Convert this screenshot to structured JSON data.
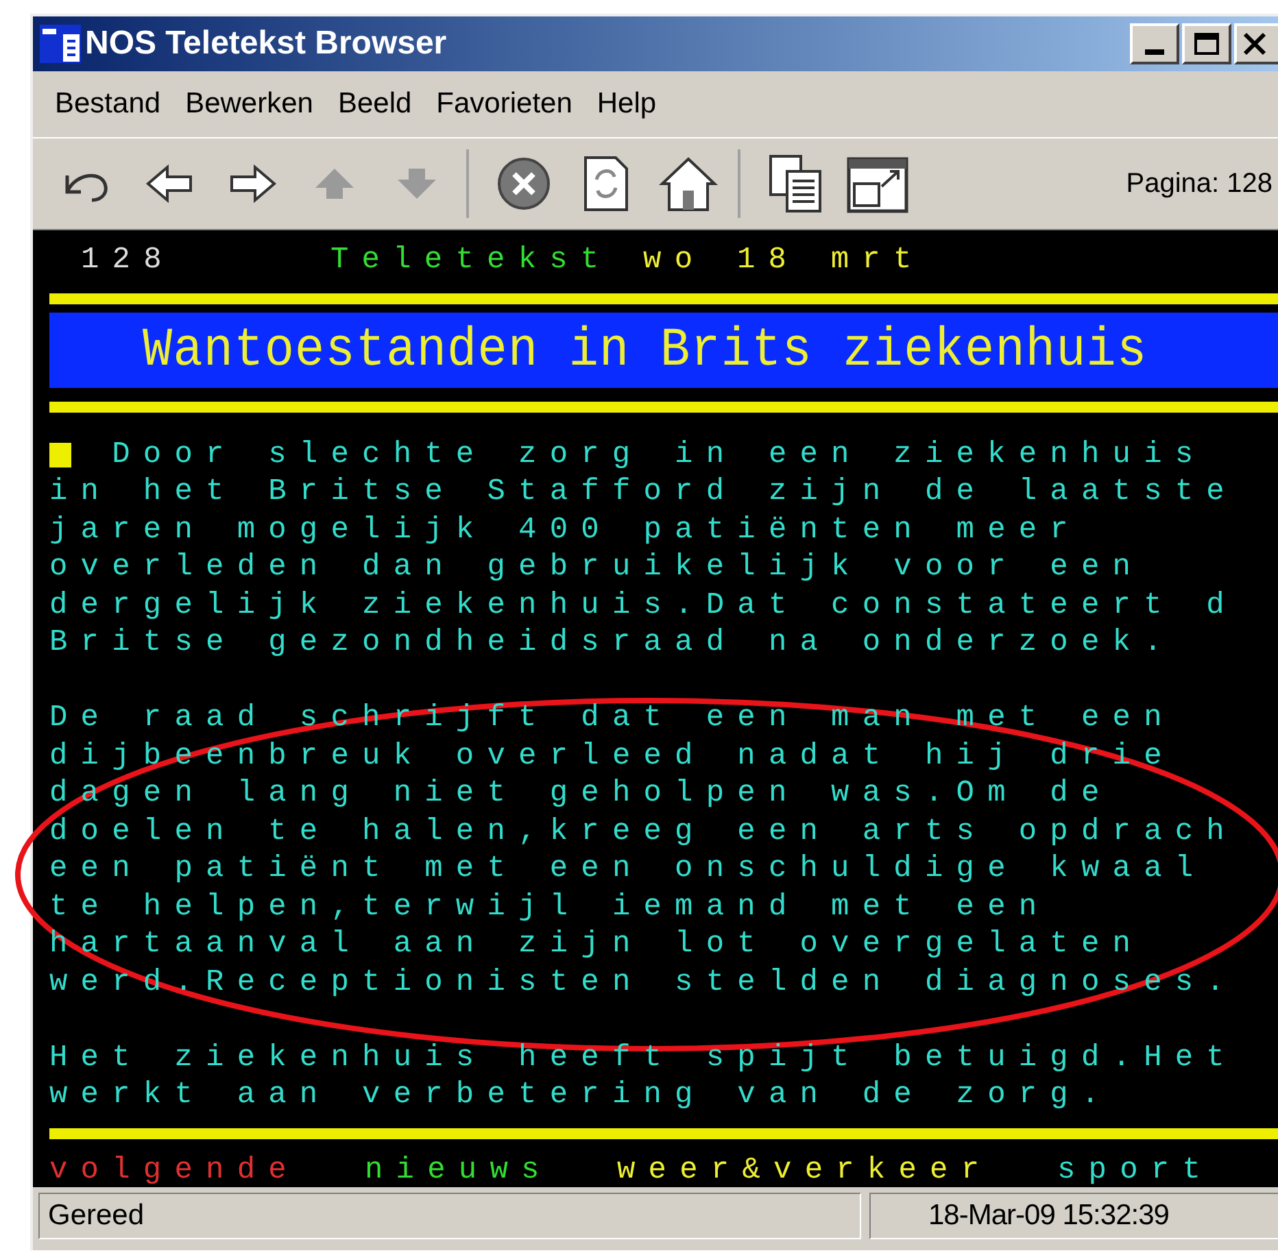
{
  "window": {
    "title": "NOS Teletekst Browser"
  },
  "menu": [
    "Bestand",
    "Bewerken",
    "Beeld",
    "Favorieten",
    "Help"
  ],
  "toolbar": {
    "groups": [
      [
        {
          "disabled": false
        },
        {
          "disabled": false
        },
        {
          "disabled": false
        },
        {
          "disabled": true
        },
        {
          "disabled": true
        }
      ],
      [
        {
          "disabled": false
        },
        {
          "disabled": false
        },
        {
          "disabled": false
        }
      ],
      [
        {
          "disabled": false
        },
        {
          "disabled": false
        }
      ]
    ],
    "page_label": "Pagina: 128"
  },
  "teletext": {
    "page": "128",
    "service": "Teletekst",
    "date": "wo 18 mrt",
    "headline": "Wantoestanden in Brits ziekenhuis",
    "paragraphs": [
      {
        "marker": true,
        "lines": [
          "Door slechte zorg in een ziekenhuis",
          "in het Britse Stafford zijn de laatste",
          "jaren mogelijk 400 patiënten meer",
          "overleden dan gebruikelijk voor een",
          "dergelijk ziekenhuis.Dat constateert d",
          "Britse gezondheidsraad na onderzoek."
        ]
      },
      {
        "marker": false,
        "lines": [
          "De raad schrijft dat een man met een",
          "dijbeenbreuk overleed nadat hij drie",
          "dagen lang niet geholpen was.Om de",
          "doelen te halen,kreeg een arts opdrach",
          "een patiënt met een onschuldige kwaal",
          "te helpen,terwijl iemand met een",
          "hartaanval aan zijn lot overgelaten",
          "werd.Receptionisten stelden diagnoses."
        ]
      },
      {
        "marker": false,
        "lines": [
          "Het ziekenhuis heeft spijt betuigd.Het",
          "werkt aan verbetering van de zorg."
        ]
      }
    ],
    "fastext": [
      {
        "label": "volgende",
        "color": "#e03030"
      },
      {
        "label": "nieuws",
        "color": "#33dd33"
      },
      {
        "label": "weer&verkeer",
        "color": "#eeee33"
      },
      {
        "label": "sport",
        "color": "#33ddcc"
      }
    ]
  },
  "status_bar": {
    "text": "Gereed",
    "datetime": "18-Mar-09 15:32:39"
  }
}
